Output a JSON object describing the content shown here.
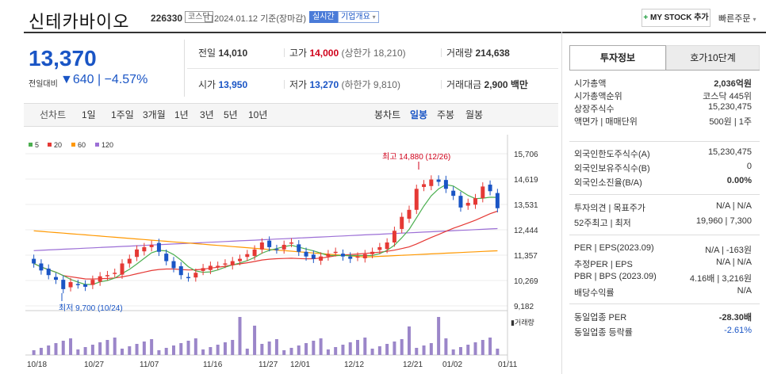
{
  "header": {
    "name": "신테카바이오",
    "code": "226330",
    "market_badge": "코스닥",
    "date_text": "2024.01.12 기준(장마감)",
    "realtime_badge": "실시간",
    "company_info": "기업개요",
    "my_stock": "+ MY STOCK 추가",
    "quick_order": "빠른주문"
  },
  "price": {
    "current": "13,370",
    "change_label": "전일대비",
    "change": "▼640",
    "change_pct": "−4.57%"
  },
  "quote": {
    "prev_label": "전일",
    "prev": "14,010",
    "high_label": "고가",
    "high": "14,000",
    "upper_limit": "(상한가 18,210)",
    "volume_label": "거래량",
    "volume": "214,638",
    "open_label": "시가",
    "open": "13,950",
    "low_label": "저가",
    "low": "13,270",
    "lower_limit": "(하한가 9,810)",
    "amount_label": "거래대금",
    "amount": "2,900",
    "amount_unit": "백만"
  },
  "periods": {
    "line": [
      "선차트",
      "1일",
      "1주일",
      "3개월",
      "1년",
      "3년",
      "5년",
      "10년"
    ],
    "candle": [
      "봉차트",
      "일봉",
      "주봉",
      "월봉"
    ]
  },
  "chart_data": {
    "type": "candlestick",
    "legend": [
      "5",
      "20",
      "60",
      "120"
    ],
    "legend_colors": [
      "#4caf50",
      "#e53935",
      "#ff9800",
      "#9c6fd6"
    ],
    "y_ticks": [
      "15,706",
      "14,619",
      "13,531",
      "12,444",
      "11,357",
      "10,269",
      "9,182"
    ],
    "ylim": [
      9182,
      15706
    ],
    "x_labels": [
      "10/18",
      "10/27",
      "11/07",
      "11/16",
      "11/27",
      "12/01",
      "12/12",
      "12/21",
      "01/02",
      "01/11"
    ],
    "max_annotation": "최고 14,880 (12/26)",
    "min_annotation": "최저 9,700 (10/24)",
    "volume_label": "거래량",
    "up_color": "#e53935",
    "down_color": "#1a55c5"
  },
  "invest": {
    "tab_active": "투자정보",
    "tab_other": "호가10단계",
    "rows1": [
      {
        "label": "시가총액",
        "value": "2,036",
        "unit": "억원"
      },
      {
        "label": "시가총액순위",
        "value": "코스닥 445위"
      },
      {
        "label": "상장주식수",
        "value": "15,230,475"
      },
      {
        "label": "액면가 | 매매단위",
        "value": "500원 | 1주"
      }
    ],
    "rows2": [
      {
        "label": "외국인한도주식수(A)",
        "value": "15,230,475"
      },
      {
        "label": "외국인보유주식수(B)",
        "value": "0"
      },
      {
        "label": "외국인소진율(B/A)",
        "value": "0.00%"
      }
    ],
    "rows3": [
      {
        "label": "투자의견 | 목표주가",
        "value": "N/A | N/A"
      },
      {
        "label": "52주최고 | 최저",
        "value": "19,960 | 7,300"
      }
    ],
    "rows4": [
      {
        "label": "PER | EPS(2023.09)",
        "value": "N/A | -163원"
      },
      {
        "label": "추정PER | EPS",
        "value": "N/A | N/A"
      },
      {
        "label": "PBR | BPS (2023.09)",
        "value": "4.16배 | 3,216원"
      },
      {
        "label": "배당수익률",
        "value": "N/A"
      }
    ],
    "rows5": [
      {
        "label": "동일업종 PER",
        "value": "-28.30배"
      },
      {
        "label": "동일업종 등락률",
        "value": "-2.61%"
      }
    ]
  }
}
